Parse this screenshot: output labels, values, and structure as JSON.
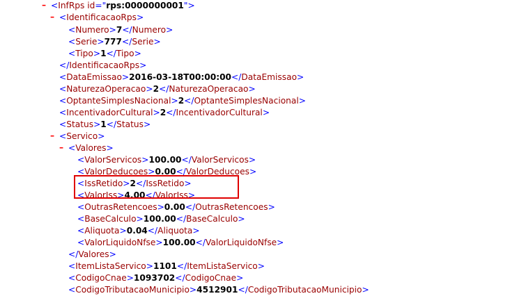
{
  "xml": {
    "infrps_tag": "InfRps",
    "infrps_attr_name": "id",
    "infrps_attr_value": "rps:0000000001",
    "identificacao_tag": "IdentificacaoRps",
    "numero_tag": "Numero",
    "numero_value": "7",
    "serie_tag": "Serie",
    "serie_value": "777",
    "tipo_tag": "Tipo",
    "tipo_value": "1",
    "dataemissao_tag": "DataEmissao",
    "dataemissao_value": "2016-03-18T00:00:00",
    "natureza_tag": "NaturezaOperacao",
    "natureza_value": "2",
    "optante_tag": "OptanteSimplesNacional",
    "optante_value": "2",
    "incentivador_tag": "IncentivadorCultural",
    "incentivador_value": "2",
    "status_tag": "Status",
    "status_value": "1",
    "servico_tag": "Servico",
    "valores_tag": "Valores",
    "valorservicos_tag": "ValorServicos",
    "valorservicos_value": "100.00",
    "valordeducoes_tag": "ValorDeducoes",
    "valordeducoes_value": "0.00",
    "issretido_tag": "IssRetido",
    "issretido_value": "2",
    "valoriss_tag": "ValorIss",
    "valoriss_value": "4.00",
    "outrasretencoes_tag": "OutrasRetencoes",
    "outrasretencoes_value": "0.00",
    "basecalculo_tag": "BaseCalculo",
    "basecalculo_value": "100.00",
    "aliquota_tag": "Aliquota",
    "aliquota_value": "0.04",
    "valorliquido_tag": "ValorLiquidoNfse",
    "valorliquido_value": "100.00",
    "itemlista_tag": "ItemListaServico",
    "itemlista_value": "1101",
    "codigocnae_tag": "CodigoCnae",
    "codigocnae_value": "1093702",
    "codigotributacao_tag": "CodigoTributacaoMunicipio",
    "codigotributacao_value": "4512901"
  },
  "toggle_symbol": "–",
  "colors": {
    "tag": "#990000",
    "bracket": "#0000ff",
    "toggle": "#ff0000",
    "highlight": "#e00000"
  }
}
